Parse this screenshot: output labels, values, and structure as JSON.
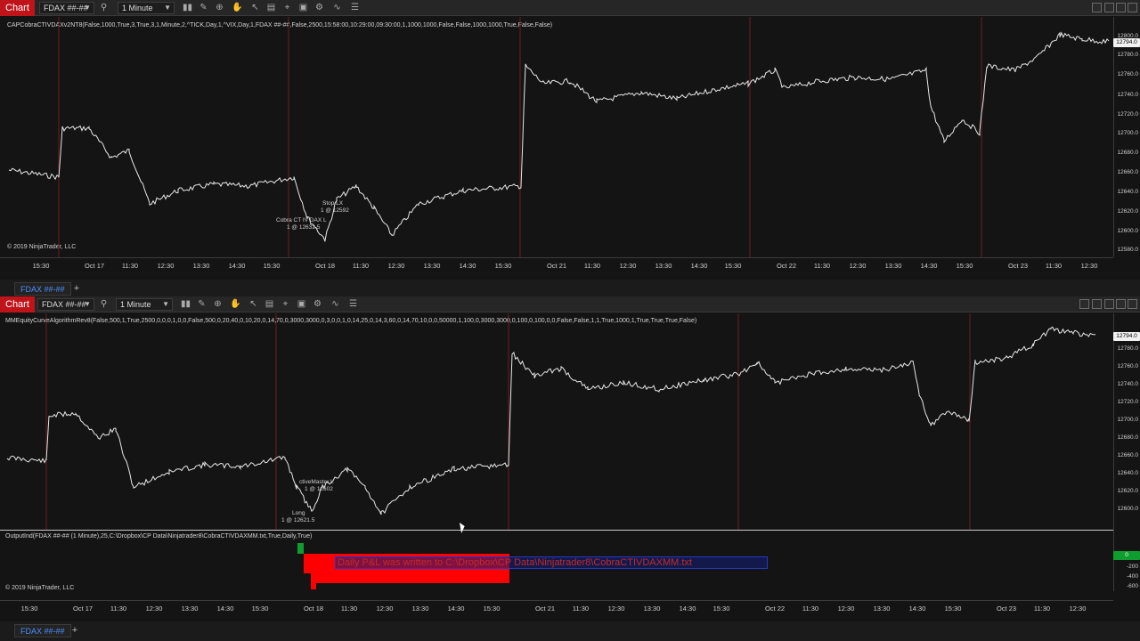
{
  "top": {
    "badge": "Chart",
    "instrument": "FDAX ##-##",
    "interval": "1 Minute",
    "indicator": "CAPCobraCTIVDAXv2NT8(False,1000,True,3,True,3,1,Minute,2,^TICK,Day,1,^VIX,Day,1,FDAX ##-##,False,2500,15:58:00,10:29:00,09:30:00,1,1000,1000,False,False,1000,1000,True,False,False)",
    "copyright": "© 2019 NinjaTrader, LLC",
    "price_ticks": [
      "12800.0",
      "12780.0",
      "12760.0",
      "12740.0",
      "12720.0",
      "12700.0",
      "12680.0",
      "12660.0",
      "12640.0",
      "12620.0",
      "12600.0",
      "12580.0"
    ],
    "last_price": "12794.0",
    "time_ticks": [
      "15:30",
      "Oct 17",
      "11:30",
      "12:30",
      "13:30",
      "14:30",
      "15:30",
      "Oct 18",
      "11:30",
      "12:30",
      "13:30",
      "14:30",
      "15:30",
      "Oct 21",
      "11:30",
      "12:30",
      "13:30",
      "14:30",
      "15:30",
      "Oct 22",
      "11:30",
      "12:30",
      "13:30",
      "14:30",
      "15:30",
      "Oct 23",
      "11:30",
      "12:30"
    ],
    "annotations": {
      "stop": "Stop LX",
      "stop_price": "1 @ 12592",
      "entry": "Cobra CT IV DAX L",
      "entry_price": "1 @ 12632.5"
    },
    "tab": "FDAX ##-##",
    "tab_add": "+"
  },
  "bottom": {
    "badge": "Chart",
    "instrument": "FDAX ##-##",
    "interval": "1 Minute",
    "indicator": "MMEquityCurveAlgorithmRev8(False,500,1,True,2500,0,0,0,1,0,0,False,500,0,20,40,0,10,20,0,14,70,0,3000,3000,0,3,0,0,1,0,14,25,0,14,3,60,0,14,70,10,0,0,50000,1,100,0,3000,3000,0,100,0,100,0,0,False,False,1,1,True,1000,1,True,True,True,False)",
    "copyright": "© 2019 NinjaTrader, LLC",
    "price_ticks": [
      "12780.0",
      "12760.0",
      "12740.0",
      "12720.0",
      "12700.0",
      "12680.0",
      "12660.0",
      "12640.0",
      "12620.0",
      "12600.0"
    ],
    "last_price": "12794.0",
    "annotations": {
      "exit": "ctiveMaster L",
      "exit_price": "1 @ 12602",
      "entry": "Long",
      "entry_price": "1 @ 12621.5"
    },
    "sub_indicator": "OutputInd(FDAX ##-## (1 Minute),25,C:\\Dropbox\\CP Data\\Ninjatrader8\\CobraCTIVDAXMM.txt,True,Daily,True)",
    "sub_ticks": [
      "0",
      "-200",
      "-400",
      "-600"
    ],
    "sub_value": "0",
    "message": "Daily P&L was written to C:\\Dropbox\\CP Data\\Ninjatrader8\\CobraCTIVDAXMM.txt",
    "time_ticks": [
      "15:30",
      "Oct 17",
      "11:30",
      "12:30",
      "13:30",
      "14:30",
      "15:30",
      "Oct 18",
      "11:30",
      "12:30",
      "13:30",
      "14:30",
      "15:30",
      "Oct 21",
      "11:30",
      "12:30",
      "13:30",
      "14:30",
      "15:30",
      "Oct 22",
      "11:30",
      "12:30",
      "13:30",
      "14:30",
      "15:30",
      "Oct 23",
      "11:30",
      "12:30"
    ],
    "tab": "FDAX ##-##",
    "tab_add": "+"
  },
  "colors": {
    "session_line": "#6b1e22",
    "price_line": "#e8e8e8",
    "pnl_bar": "#ff0000",
    "pnl_up": "#0f9d2f",
    "chart_badge": "#c0141b"
  }
}
